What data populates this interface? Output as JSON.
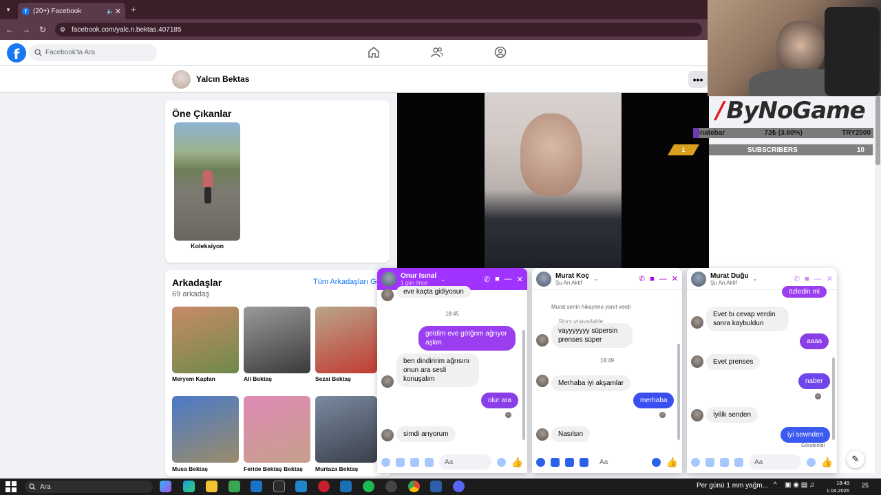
{
  "browser": {
    "tab_title": "(20+) Facebook",
    "url": "facebook.com/yalc.n.bektas.407185"
  },
  "fb_header": {
    "search_placeholder": "Facebook'ta Ara"
  },
  "profile": {
    "name": "Yalcın Bektas",
    "more_label": "•••"
  },
  "highlights": {
    "title": "Öne Çıkanlar",
    "items": [
      {
        "label": "Koleksiyon"
      }
    ]
  },
  "friends": {
    "title": "Arkadaşlar",
    "count": "69 arkadaş",
    "see_all": "Tüm Arkadaşları Gö",
    "list": [
      {
        "name": "Meryem Kaplan",
        "color_a": "#c98a6a",
        "color_b": "#6e8a4a"
      },
      {
        "name": "Ali Bektaş",
        "color_a": "#9a9a9a",
        "color_b": "#3a3a3a"
      },
      {
        "name": "Sezai Bektaş",
        "color_a": "#b9a58a",
        "color_b": "#c23b32"
      },
      {
        "name": "Musa Bektaş",
        "color_a": "#4a7ac8",
        "color_b": "#9b8c6a"
      },
      {
        "name": "Feride Bektaş Bektaş",
        "color_a": "#e08ab6",
        "color_b": "#c6a08a"
      },
      {
        "name": "Murtaza Bektaş",
        "color_a": "#7a8aa0",
        "color_b": "#3a3f4a"
      }
    ]
  },
  "stream": {
    "brand": "ByNoGame",
    "donation_label": "onatebar",
    "donation_amount": "72₺ (3.60%)",
    "donation_goal": "TRY2000",
    "donation_progress": 0.036,
    "subs_label": "SUBSCRIBERS",
    "subs_count": "10",
    "rank": "1"
  },
  "chats": [
    {
      "name": "Onur Isınal",
      "status": "1 gün önce",
      "accent": "#a033ff",
      "header_active": true,
      "messages": [
        {
          "dir": "in",
          "text": "eve kaçta gidiyosun"
        },
        {
          "dir": "time",
          "text": "18:45"
        },
        {
          "dir": "out",
          "text": "geldim eve götğnm ağrıyor aşkm"
        },
        {
          "dir": "in",
          "text": "ben dindiririm ağrısını onun ara sesli konuşalım"
        },
        {
          "dir": "out",
          "text": "olur ara"
        },
        {
          "dir": "in",
          "text": "simdi arıyorum"
        }
      ],
      "input_placeholder": "Aa"
    },
    {
      "name": "Murat Koç",
      "status": "Şu An Aktif",
      "accent": "#b000e0",
      "header_active": false,
      "story_reply": "Murat senin hikayene yanıt verdi",
      "story_unavailable": "Story unavailable",
      "messages": [
        {
          "dir": "in",
          "text": "vayyyyyyy süpersin prenses süper"
        },
        {
          "dir": "time",
          "text": "18:49"
        },
        {
          "dir": "in",
          "text": "Merhaba iyi akşamlar"
        },
        {
          "dir": "out",
          "text": "merhaba"
        },
        {
          "dir": "in",
          "text": "Nasılsın"
        }
      ],
      "input_placeholder": "Aa"
    },
    {
      "name": "Murat Duğu",
      "status": "Şu An Aktif",
      "accent": "#8a2be2",
      "header_active": false,
      "messages": [
        {
          "dir": "out",
          "text": "özledin mi"
        },
        {
          "dir": "in",
          "text": "Evet bı cevap verdin sonra kaybuldun"
        },
        {
          "dir": "out",
          "text": "aaaa"
        },
        {
          "dir": "in",
          "text": "Evet prenses"
        },
        {
          "dir": "out",
          "text": "naber"
        },
        {
          "dir": "in",
          "text": "İyilik senden"
        },
        {
          "dir": "out",
          "text": "iyi sewnden"
        }
      ],
      "sent_status": "Gönderildi",
      "input_placeholder": "Aa"
    }
  ],
  "taskbar": {
    "search_label": "Ara",
    "weather": "Per günü 1 mm yağm...",
    "time": "18:49",
    "date": "1.04.2026",
    "notification_count": "25"
  }
}
